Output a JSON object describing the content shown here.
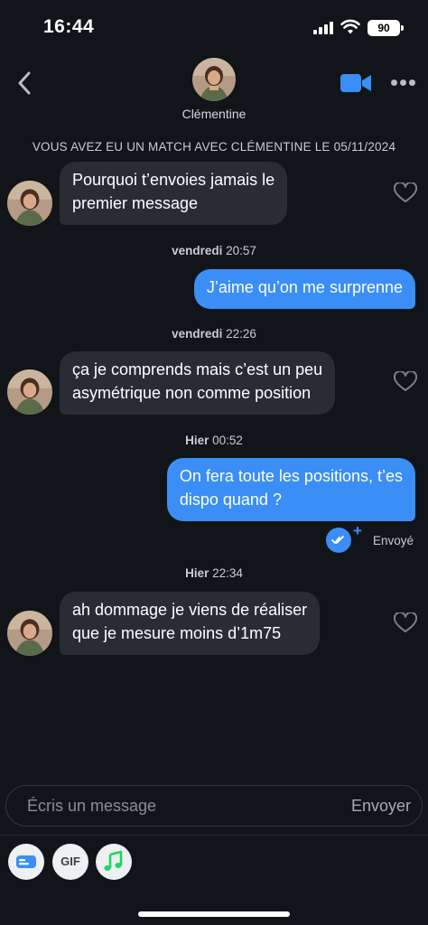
{
  "status_bar": {
    "time": "16:44",
    "battery": "90"
  },
  "header": {
    "contact_name": "Clémentine"
  },
  "match_notice": "VOUS AVEZ EU UN MATCH AVEC CLÉMENTINE LE 05/11/2024",
  "messages": [
    {
      "direction": "incoming",
      "lines": [
        "Pourquoi t’envoies jamais le",
        "premier message"
      ]
    },
    {
      "timestamp_day": "vendredi",
      "timestamp_time": "20:57"
    },
    {
      "direction": "outgoing",
      "lines": [
        "J’aime qu’on me surprenne"
      ]
    },
    {
      "timestamp_day": "vendredi",
      "timestamp_time": "22:26"
    },
    {
      "direction": "incoming",
      "lines": [
        "ça je comprends mais c’est un peu",
        "asymétrique non comme position"
      ]
    },
    {
      "timestamp_day": "Hier",
      "timestamp_time": "00:52"
    },
    {
      "direction": "outgoing",
      "lines": [
        "On fera toute les positions, t’es",
        "dispo quand ?"
      ],
      "status": "Envoyé"
    },
    {
      "timestamp_day": "Hier",
      "timestamp_time": "22:34"
    },
    {
      "direction": "incoming",
      "lines": [
        "ah dommage je viens de réaliser",
        "que je mesure moins d’1m75"
      ]
    }
  ],
  "composer": {
    "placeholder": "Écris un message",
    "send_label": "Envoyer"
  },
  "toolbar": {
    "gif_label": "GIF"
  },
  "colors": {
    "accent": "#3a8ef6",
    "background": "#111418",
    "incoming_bubble": "#292c33",
    "music_green": "#1ed760"
  },
  "icons": [
    "back-chevron-icon",
    "video-call-icon",
    "more-options-icon",
    "heart-icon",
    "read-receipt-icon",
    "sticker-card-icon",
    "gif-icon",
    "music-note-icon"
  ]
}
